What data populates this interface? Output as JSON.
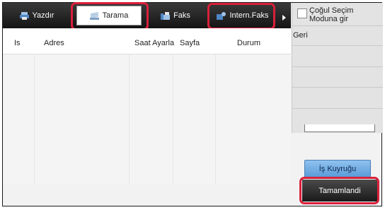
{
  "tabs": [
    {
      "label": "Yazdır",
      "icon": "printer-icon",
      "active": false
    },
    {
      "label": "Tarama",
      "icon": "scanner-icon",
      "active": true
    },
    {
      "label": "Faks",
      "icon": "fax-icon",
      "active": false
    },
    {
      "label": "Intern.Faks",
      "icon": "internet-fax-icon",
      "active": false
    }
  ],
  "columns": [
    "Is",
    "Adres",
    "Saat Ayarla",
    "Sayfa",
    "Durum"
  ],
  "side": {
    "multi_select_line1": "Çoğul Seçim",
    "multi_select_line2": "Moduna gir",
    "back_label": "Geri",
    "queue_label": "İş Kuyruğu",
    "done_label": "Tamamlandi"
  },
  "colors": {
    "highlight": "#d8203a",
    "tab_bar": "#1f1f1f",
    "queue_button": "#6aa6e0"
  }
}
